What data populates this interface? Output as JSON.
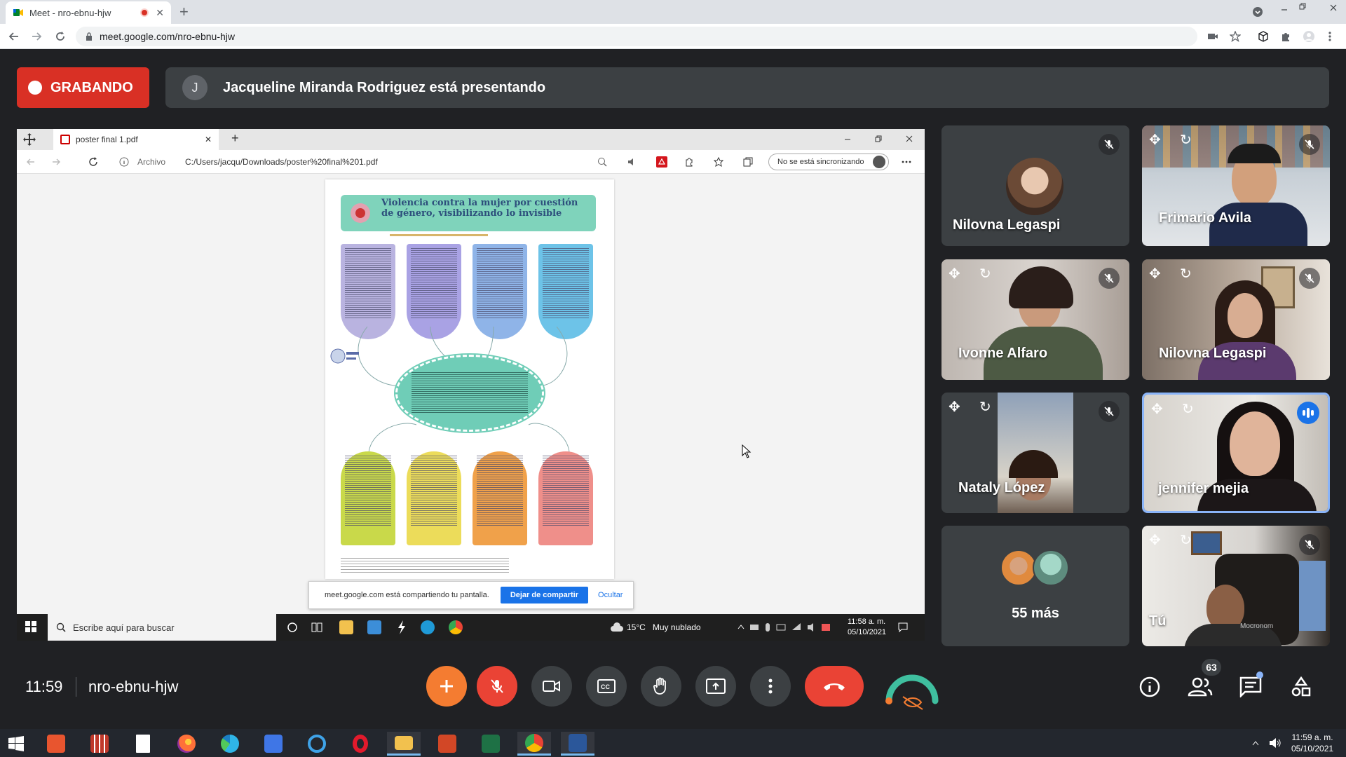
{
  "browser": {
    "tab_title": "Meet - nro-ebnu-hjw",
    "tab_close": "✕",
    "new_tab": "+",
    "url": "meet.google.com/nro-ebnu-hjw"
  },
  "meet_header": {
    "recording_label": "GRABANDO",
    "presenter_initial": "J",
    "presenter_text": "Jacqueline Miranda Rodriguez está presentando"
  },
  "shared_screen": {
    "edge_tab_title": "poster final 1.pdf",
    "edge_tab_close": "✕",
    "edge_new_tab": "+",
    "address_prefix": "Archivo",
    "address_path": "C:/Users/jacqu/Downloads/poster%20final%201.pdf",
    "sync_status": "No se está sincronizando",
    "poster_title": "Violencia contra la mujer por cuestión de género, visibilizando lo invisible",
    "poster_panels_top": [
      {
        "color": "#b9b3e0"
      },
      {
        "color": "#a9a2e4"
      },
      {
        "color": "#8fb4e8"
      },
      {
        "color": "#6dc3e8"
      }
    ],
    "poster_panels_bottom": [
      {
        "color": "#c9d94a"
      },
      {
        "color": "#ecdc5a"
      },
      {
        "color": "#f0a14a"
      },
      {
        "color": "#ef8f8a"
      }
    ],
    "sharing_notice": "meet.google.com está compartiendo tu pantalla.",
    "stop_sharing_button": "Dejar de compartir",
    "hide_button": "Ocultar",
    "win_search_placeholder": "Escribe aquí para buscar",
    "weather_temp": "15°C",
    "weather_desc": "Muy nublado",
    "clock_time": "11:58 a. m.",
    "clock_date": "05/10/2021"
  },
  "participants": [
    {
      "name": "Nilovna Legaspi",
      "muted": true,
      "type": "avatar"
    },
    {
      "name": "Frimario Avila",
      "muted": true,
      "type": "video"
    },
    {
      "name": "Ivonne Alfaro",
      "muted": true,
      "type": "video"
    },
    {
      "name": "Nilovna Legaspi",
      "muted": true,
      "type": "video"
    },
    {
      "name": "Nataly López",
      "muted": true,
      "type": "video"
    },
    {
      "name": "jennifer mejia",
      "muted": false,
      "speaking": true,
      "type": "video"
    },
    {
      "name": "55 más",
      "type": "overflow"
    },
    {
      "name": "Tú",
      "muted": true,
      "type": "video",
      "watermark": "Mocronom"
    }
  ],
  "bottom_bar": {
    "time": "11:59",
    "meeting_code": "nro-ebnu-hjw",
    "participant_count": "63"
  },
  "host_taskbar": {
    "clock_time": "11:59 a. m.",
    "clock_date": "05/10/2021"
  },
  "colors": {
    "meet_background": "#202124",
    "tile_background": "#3c4043",
    "recording_red": "#d93025",
    "end_call_red": "#ea4335",
    "activities_orange": "#f47c31",
    "active_speaker_border": "#8ab4f8",
    "speaking_blue": "#1a73e8"
  }
}
